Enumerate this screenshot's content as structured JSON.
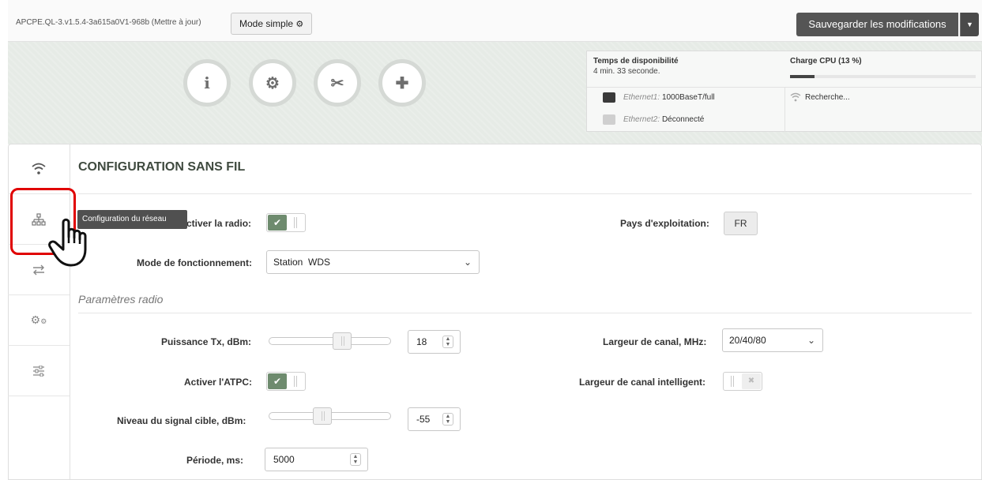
{
  "topbar": {
    "firmware": "APCPE.QL-3.v1.5.4-3a615a0V1-968b (Mettre à jour)",
    "mode_button": "Mode simple",
    "save_button": "Sauvegarder les modifications"
  },
  "nav_circles": [
    {
      "icon": "info-icon",
      "glyph": "i"
    },
    {
      "icon": "gear-icon",
      "glyph": "⚙"
    },
    {
      "icon": "tools-icon",
      "glyph": "✂"
    },
    {
      "icon": "medkit-icon",
      "glyph": "✚"
    }
  ],
  "status": {
    "uptime_title": "Temps de disponibilité",
    "uptime_value": "4 min. 33 seconde.",
    "cpu_title": "Charge CPU (13 %)",
    "cpu_percent": 13,
    "eth1_name": "Ethernet1:",
    "eth1_value": "1000BaseT/full",
    "eth2_name": "Ethernet2:",
    "eth2_value": "Déconnecté",
    "wifi_status": "Recherche..."
  },
  "sidebar": {
    "items": [
      "wifi-icon",
      "network-icon",
      "transfer-icon",
      "gears-icon",
      "sliders-icon"
    ],
    "tooltip": "Configuration du réseau"
  },
  "section": {
    "title": "CONFIGURATION SANS FIL",
    "radio_label": "Activer la radio:",
    "radio_label_visible": "ctiver la radio:",
    "radio_on": true,
    "country_label": "Pays d'exploitation:",
    "country_value": "FR",
    "mode_label": "Mode de fonctionnement:",
    "mode_value": "Station  WDS",
    "radio_params": "Paramètres radio",
    "tx_label": "Puissance Tx, dBm:",
    "tx_value": "18",
    "tx_slider_fraction": 0.62,
    "channel_width_label": "Largeur de canal, MHz:",
    "channel_width_value": "20/40/80",
    "atpc_label": "Activer l'ATPC:",
    "atpc_on": true,
    "smart_width_label": "Largeur de canal intelligent:",
    "smart_width_on": false,
    "signal_label": "Niveau du signal cible, dBm:",
    "signal_value": "-55",
    "signal_slider_fraction": 0.43,
    "period_label": "Période, ms:",
    "period_value": "5000"
  }
}
